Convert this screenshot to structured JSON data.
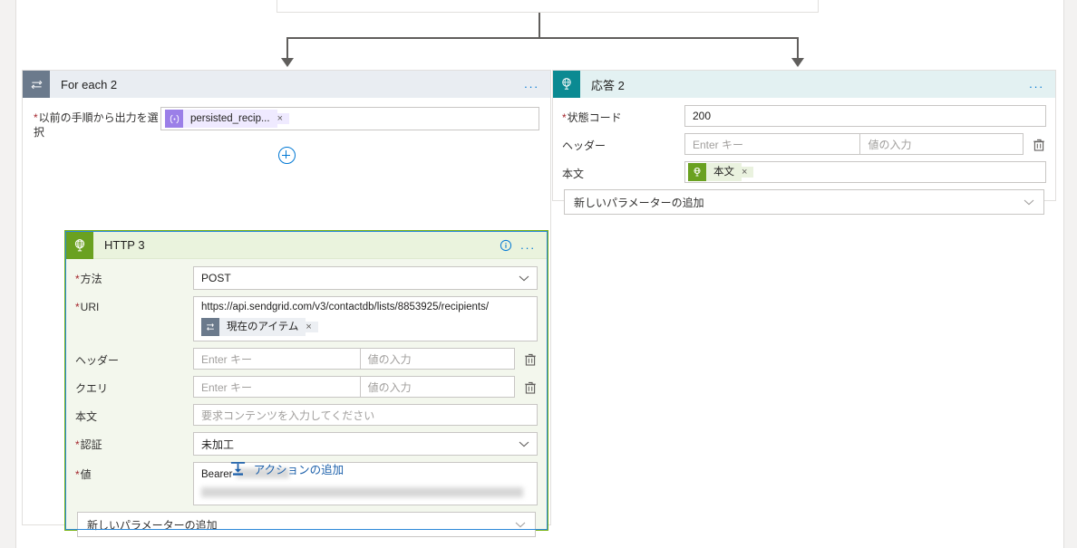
{
  "connector": {
    "arrow_left": "arrow-down",
    "arrow_right": "arrow-down"
  },
  "foreach_card": {
    "icon": "loop-icon",
    "title": "For each 2",
    "more_label": "...",
    "select_field": {
      "label": "以前の手順から出力を選択",
      "required": true,
      "token": {
        "icon": "expression-icon",
        "icon_glyph": "⟨ᐧ⟩",
        "text": "persisted_recip...",
        "remove": "×"
      }
    },
    "add_token_button": "plus-icon",
    "http_card": {
      "icon": "globe-icon",
      "title": "HTTP 3",
      "info_icon": "info-icon",
      "more_label": "...",
      "fields": [
        {
          "label": "方法",
          "required": true,
          "type": "select",
          "value": "POST"
        },
        {
          "label": "URI",
          "required": true,
          "type": "uri",
          "value": "https://api.sendgrid.com/v3/contactdb/lists/8853925/recipients/",
          "token": {
            "icon": "foreach-item-icon",
            "text": "現在のアイテム",
            "remove": "×"
          }
        },
        {
          "label": "ヘッダー",
          "required": false,
          "type": "keyvalue",
          "key_placeholder": "Enter キー",
          "value_placeholder": "値の入力",
          "delete_icon": "trash-icon"
        },
        {
          "label": "クエリ",
          "required": false,
          "type": "keyvalue",
          "key_placeholder": "Enter キー",
          "value_placeholder": "値の入力",
          "delete_icon": "trash-icon"
        },
        {
          "label": "本文",
          "required": false,
          "type": "text",
          "placeholder": "要求コンテンツを入力してください"
        },
        {
          "label": "認証",
          "required": true,
          "type": "select",
          "value": "未加工"
        },
        {
          "label": "値",
          "required": true,
          "type": "secret",
          "value": "Bearer",
          "redacted": true
        }
      ],
      "add_parameter": "新しいパラメーターの追加"
    },
    "add_action": {
      "icon": "add-action-icon",
      "label": "アクションの追加"
    }
  },
  "response_card": {
    "icon": "response-icon",
    "title": "応答 2",
    "more_label": "...",
    "fields": [
      {
        "label": "状態コード",
        "required": true,
        "type": "text",
        "value": "200"
      },
      {
        "label": "ヘッダー",
        "required": false,
        "type": "keyvalue",
        "key_placeholder": "Enter キー",
        "value_placeholder": "値の入力",
        "delete_icon": "trash-icon"
      },
      {
        "label": "本文",
        "required": false,
        "type": "token",
        "token": {
          "icon": "response-body-icon",
          "text": "本文",
          "remove": "×"
        }
      }
    ],
    "add_parameter": "新しいパラメーターの追加"
  },
  "colors": {
    "accent_blue": "#0078d4",
    "http_green": "#6aa121",
    "http_border": "#7ab317",
    "response_teal": "#0b8a92",
    "foreach_gray": "#6b7a8c",
    "required_red": "#a4262c",
    "connector": "#605e5c"
  }
}
